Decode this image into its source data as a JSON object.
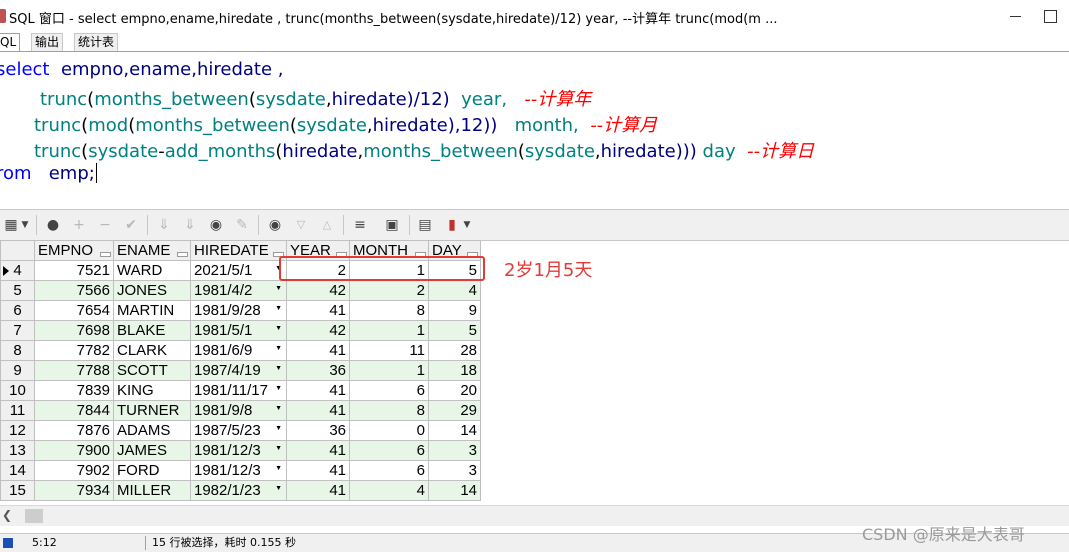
{
  "window": {
    "title": "SQL 窗口 - select empno,ename,hiredate , trunc(months_between(sysdate,hiredate)/12) year, --计算年 trunc(mod(m ..."
  },
  "tabs": [
    {
      "label": "QL"
    },
    {
      "label": "输出"
    },
    {
      "label": "统计表"
    }
  ],
  "sql": {
    "line1": {
      "kw": "select",
      "cols": "empno,ename,hiredate ,"
    },
    "line2": {
      "fn1": "trunc",
      "fn2": "months_between",
      "fn3": "sysdate",
      "rest": "hiredate)/12)",
      "alias": "year,",
      "comment": "--计算年"
    },
    "line3": {
      "fn1": "trunc",
      "fn2": "mod",
      "fn3": "months_between",
      "fn4": "sysdate",
      "rest": "hiredate),12))",
      "alias": "month,",
      "comment": "--计算月"
    },
    "line4": {
      "fn1": "trunc",
      "fn2": "sysdate",
      "fn3": "add_months",
      "id1": "hiredate",
      "fn4": "months_between",
      "fn5": "sysdate",
      "rest": "hiredate)))",
      "alias": "day",
      "comment": "--计算日"
    },
    "line5": {
      "kw": "rom",
      "table": "emp;"
    }
  },
  "grid": {
    "columns": [
      "EMPNO",
      "ENAME",
      "HIREDATE",
      "YEAR",
      "MONTH",
      "DAY"
    ],
    "rows": [
      {
        "rn": "4",
        "empno": "7521",
        "ename": "WARD",
        "hiredate": "2021/5/1",
        "year": "2",
        "month": "1",
        "day": "5"
      },
      {
        "rn": "5",
        "empno": "7566",
        "ename": "JONES",
        "hiredate": "1981/4/2",
        "year": "42",
        "month": "2",
        "day": "4"
      },
      {
        "rn": "6",
        "empno": "7654",
        "ename": "MARTIN",
        "hiredate": "1981/9/28",
        "year": "41",
        "month": "8",
        "day": "9"
      },
      {
        "rn": "7",
        "empno": "7698",
        "ename": "BLAKE",
        "hiredate": "1981/5/1",
        "year": "42",
        "month": "1",
        "day": "5"
      },
      {
        "rn": "8",
        "empno": "7782",
        "ename": "CLARK",
        "hiredate": "1981/6/9",
        "year": "41",
        "month": "11",
        "day": "28"
      },
      {
        "rn": "9",
        "empno": "7788",
        "ename": "SCOTT",
        "hiredate": "1987/4/19",
        "year": "36",
        "month": "1",
        "day": "18"
      },
      {
        "rn": "10",
        "empno": "7839",
        "ename": "KING",
        "hiredate": "1981/11/17",
        "year": "41",
        "month": "6",
        "day": "20"
      },
      {
        "rn": "11",
        "empno": "7844",
        "ename": "TURNER",
        "hiredate": "1981/9/8",
        "year": "41",
        "month": "8",
        "day": "29"
      },
      {
        "rn": "12",
        "empno": "7876",
        "ename": "ADAMS",
        "hiredate": "1987/5/23",
        "year": "36",
        "month": "0",
        "day": "14"
      },
      {
        "rn": "13",
        "empno": "7900",
        "ename": "JAMES",
        "hiredate": "1981/12/3",
        "year": "41",
        "month": "6",
        "day": "3"
      },
      {
        "rn": "14",
        "empno": "7902",
        "ename": "FORD",
        "hiredate": "1981/12/3",
        "year": "41",
        "month": "6",
        "day": "3"
      },
      {
        "rn": "15",
        "empno": "7934",
        "ename": "MILLER",
        "hiredate": "1982/1/23",
        "year": "41",
        "month": "4",
        "day": "14"
      }
    ]
  },
  "annotation": {
    "text": "2岁1月5天",
    "color": "#e53935"
  },
  "status": {
    "position": "5:12",
    "message": "15 行被选择，耗时 0.155 秒"
  },
  "watermark": "CSDN @原来是大表哥",
  "icons": {
    "toolbar": [
      "grid-icon",
      "lock-icon",
      "add-record-icon",
      "delete-record-icon",
      "post-changes-icon",
      "fetch-next-icon",
      "fetch-last-icon",
      "find-icon",
      "clear-icon",
      "query-by-example-icon",
      "previous-icon",
      "next-icon",
      "export-icon",
      "save-icon",
      "print-icon",
      "chart-icon"
    ]
  }
}
